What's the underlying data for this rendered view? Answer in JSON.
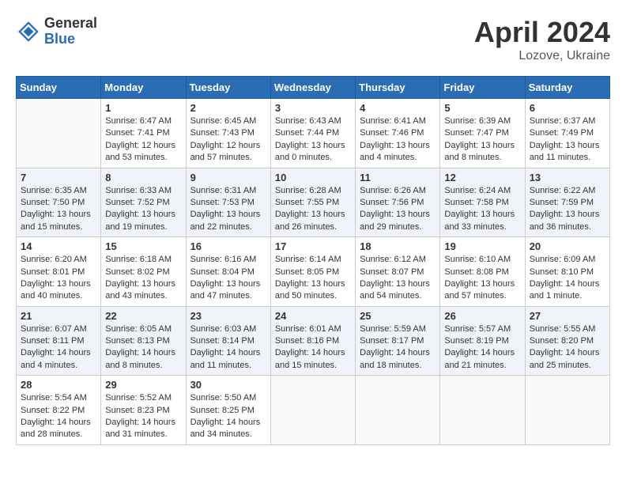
{
  "header": {
    "logo_general": "General",
    "logo_blue": "Blue",
    "month_title": "April 2024",
    "location": "Lozove, Ukraine"
  },
  "days_of_week": [
    "Sunday",
    "Monday",
    "Tuesday",
    "Wednesday",
    "Thursday",
    "Friday",
    "Saturday"
  ],
  "weeks": [
    [
      {
        "day": "",
        "sunrise": "",
        "sunset": "",
        "daylight": ""
      },
      {
        "day": "1",
        "sunrise": "Sunrise: 6:47 AM",
        "sunset": "Sunset: 7:41 PM",
        "daylight": "Daylight: 12 hours and 53 minutes."
      },
      {
        "day": "2",
        "sunrise": "Sunrise: 6:45 AM",
        "sunset": "Sunset: 7:43 PM",
        "daylight": "Daylight: 12 hours and 57 minutes."
      },
      {
        "day": "3",
        "sunrise": "Sunrise: 6:43 AM",
        "sunset": "Sunset: 7:44 PM",
        "daylight": "Daylight: 13 hours and 0 minutes."
      },
      {
        "day": "4",
        "sunrise": "Sunrise: 6:41 AM",
        "sunset": "Sunset: 7:46 PM",
        "daylight": "Daylight: 13 hours and 4 minutes."
      },
      {
        "day": "5",
        "sunrise": "Sunrise: 6:39 AM",
        "sunset": "Sunset: 7:47 PM",
        "daylight": "Daylight: 13 hours and 8 minutes."
      },
      {
        "day": "6",
        "sunrise": "Sunrise: 6:37 AM",
        "sunset": "Sunset: 7:49 PM",
        "daylight": "Daylight: 13 hours and 11 minutes."
      }
    ],
    [
      {
        "day": "7",
        "sunrise": "Sunrise: 6:35 AM",
        "sunset": "Sunset: 7:50 PM",
        "daylight": "Daylight: 13 hours and 15 minutes."
      },
      {
        "day": "8",
        "sunrise": "Sunrise: 6:33 AM",
        "sunset": "Sunset: 7:52 PM",
        "daylight": "Daylight: 13 hours and 19 minutes."
      },
      {
        "day": "9",
        "sunrise": "Sunrise: 6:31 AM",
        "sunset": "Sunset: 7:53 PM",
        "daylight": "Daylight: 13 hours and 22 minutes."
      },
      {
        "day": "10",
        "sunrise": "Sunrise: 6:28 AM",
        "sunset": "Sunset: 7:55 PM",
        "daylight": "Daylight: 13 hours and 26 minutes."
      },
      {
        "day": "11",
        "sunrise": "Sunrise: 6:26 AM",
        "sunset": "Sunset: 7:56 PM",
        "daylight": "Daylight: 13 hours and 29 minutes."
      },
      {
        "day": "12",
        "sunrise": "Sunrise: 6:24 AM",
        "sunset": "Sunset: 7:58 PM",
        "daylight": "Daylight: 13 hours and 33 minutes."
      },
      {
        "day": "13",
        "sunrise": "Sunrise: 6:22 AM",
        "sunset": "Sunset: 7:59 PM",
        "daylight": "Daylight: 13 hours and 36 minutes."
      }
    ],
    [
      {
        "day": "14",
        "sunrise": "Sunrise: 6:20 AM",
        "sunset": "Sunset: 8:01 PM",
        "daylight": "Daylight: 13 hours and 40 minutes."
      },
      {
        "day": "15",
        "sunrise": "Sunrise: 6:18 AM",
        "sunset": "Sunset: 8:02 PM",
        "daylight": "Daylight: 13 hours and 43 minutes."
      },
      {
        "day": "16",
        "sunrise": "Sunrise: 6:16 AM",
        "sunset": "Sunset: 8:04 PM",
        "daylight": "Daylight: 13 hours and 47 minutes."
      },
      {
        "day": "17",
        "sunrise": "Sunrise: 6:14 AM",
        "sunset": "Sunset: 8:05 PM",
        "daylight": "Daylight: 13 hours and 50 minutes."
      },
      {
        "day": "18",
        "sunrise": "Sunrise: 6:12 AM",
        "sunset": "Sunset: 8:07 PM",
        "daylight": "Daylight: 13 hours and 54 minutes."
      },
      {
        "day": "19",
        "sunrise": "Sunrise: 6:10 AM",
        "sunset": "Sunset: 8:08 PM",
        "daylight": "Daylight: 13 hours and 57 minutes."
      },
      {
        "day": "20",
        "sunrise": "Sunrise: 6:09 AM",
        "sunset": "Sunset: 8:10 PM",
        "daylight": "Daylight: 14 hours and 1 minute."
      }
    ],
    [
      {
        "day": "21",
        "sunrise": "Sunrise: 6:07 AM",
        "sunset": "Sunset: 8:11 PM",
        "daylight": "Daylight: 14 hours and 4 minutes."
      },
      {
        "day": "22",
        "sunrise": "Sunrise: 6:05 AM",
        "sunset": "Sunset: 8:13 PM",
        "daylight": "Daylight: 14 hours and 8 minutes."
      },
      {
        "day": "23",
        "sunrise": "Sunrise: 6:03 AM",
        "sunset": "Sunset: 8:14 PM",
        "daylight": "Daylight: 14 hours and 11 minutes."
      },
      {
        "day": "24",
        "sunrise": "Sunrise: 6:01 AM",
        "sunset": "Sunset: 8:16 PM",
        "daylight": "Daylight: 14 hours and 15 minutes."
      },
      {
        "day": "25",
        "sunrise": "Sunrise: 5:59 AM",
        "sunset": "Sunset: 8:17 PM",
        "daylight": "Daylight: 14 hours and 18 minutes."
      },
      {
        "day": "26",
        "sunrise": "Sunrise: 5:57 AM",
        "sunset": "Sunset: 8:19 PM",
        "daylight": "Daylight: 14 hours and 21 minutes."
      },
      {
        "day": "27",
        "sunrise": "Sunrise: 5:55 AM",
        "sunset": "Sunset: 8:20 PM",
        "daylight": "Daylight: 14 hours and 25 minutes."
      }
    ],
    [
      {
        "day": "28",
        "sunrise": "Sunrise: 5:54 AM",
        "sunset": "Sunset: 8:22 PM",
        "daylight": "Daylight: 14 hours and 28 minutes."
      },
      {
        "day": "29",
        "sunrise": "Sunrise: 5:52 AM",
        "sunset": "Sunset: 8:23 PM",
        "daylight": "Daylight: 14 hours and 31 minutes."
      },
      {
        "day": "30",
        "sunrise": "Sunrise: 5:50 AM",
        "sunset": "Sunset: 8:25 PM",
        "daylight": "Daylight: 14 hours and 34 minutes."
      },
      {
        "day": "",
        "sunrise": "",
        "sunset": "",
        "daylight": ""
      },
      {
        "day": "",
        "sunrise": "",
        "sunset": "",
        "daylight": ""
      },
      {
        "day": "",
        "sunrise": "",
        "sunset": "",
        "daylight": ""
      },
      {
        "day": "",
        "sunrise": "",
        "sunset": "",
        "daylight": ""
      }
    ]
  ]
}
